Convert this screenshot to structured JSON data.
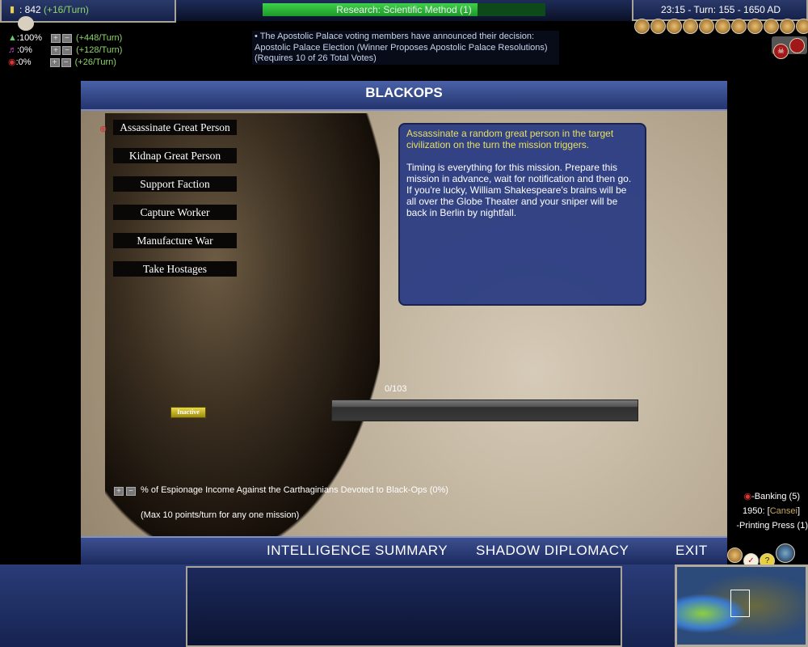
{
  "top_left": {
    "gold": ": 842",
    "gold_rate": "(+16/Turn)",
    "sliders": [
      {
        "icon": "science-flask-icon",
        "pct": ":100%",
        "rate": "(+448/Turn)",
        "plus": "+",
        "minus": "−"
      },
      {
        "icon": "culture-music-icon",
        "pct": ":0%",
        "rate": "(+128/Turn)",
        "plus": "+",
        "minus": "−"
      },
      {
        "icon": "espionage-eye-icon",
        "pct": ":0%",
        "rate": "(+26/Turn)",
        "plus": "+",
        "minus": "−"
      }
    ]
  },
  "research": {
    "label": "Research: Scientific Method (1)",
    "progress": 0.76
  },
  "message": {
    "line1": "• The Apostolic Palace voting members have announced their decision:",
    "line2": "Apostolic Palace Election (Winner Proposes Apostolic Palace Resolutions)",
    "line3": "(Requires 10 of 26 Total Votes)"
  },
  "top_right": {
    "clock": "23:15 - Turn: 155 - 1650 AD",
    "advisors": [
      "domestic",
      "financial",
      "civics",
      "foreign",
      "military",
      "technology",
      "religious",
      "corporation",
      "victory",
      "info",
      "espionage"
    ]
  },
  "screen": {
    "title": "BLACKOPS",
    "missions": [
      "Assassinate Great Person",
      "Kidnap Great Person",
      "Support Faction",
      "Capture Worker",
      "Manufacture War",
      "Take Hostages"
    ],
    "desc_highlight": "Assassinate a random great person in the target civilization on the turn the mission triggers.",
    "desc_body": "Timing is everything for this mission. Prepare this mission in advance, wait for notification and then go. If you're lucky, William Shakespeare's brains will be all over the Globe Theater and your sniper will be back in Berlin by nightfall.",
    "progress_label": "0/103",
    "progress": 0,
    "status": "Inactive",
    "income_label": "% of Espionage Income Against the Carthaginians Devoted to Black-Ops (0%)",
    "max_note": "(Max 10 points/turn for any one mission)",
    "plus": "+",
    "minus": "−",
    "footer": {
      "intel": "INTELLIGENCE SUMMARY",
      "shadow": "SHADOW DIPLOMACY",
      "exit": "EXIT"
    }
  },
  "side": {
    "banking": "-Banking (5)",
    "year": "1950: [",
    "cansei": "Cansei",
    "close": "]",
    "printing": "-Printing Press (1)"
  },
  "colors": {
    "highlight": "#e8e060",
    "rate": "#8fd46a"
  }
}
